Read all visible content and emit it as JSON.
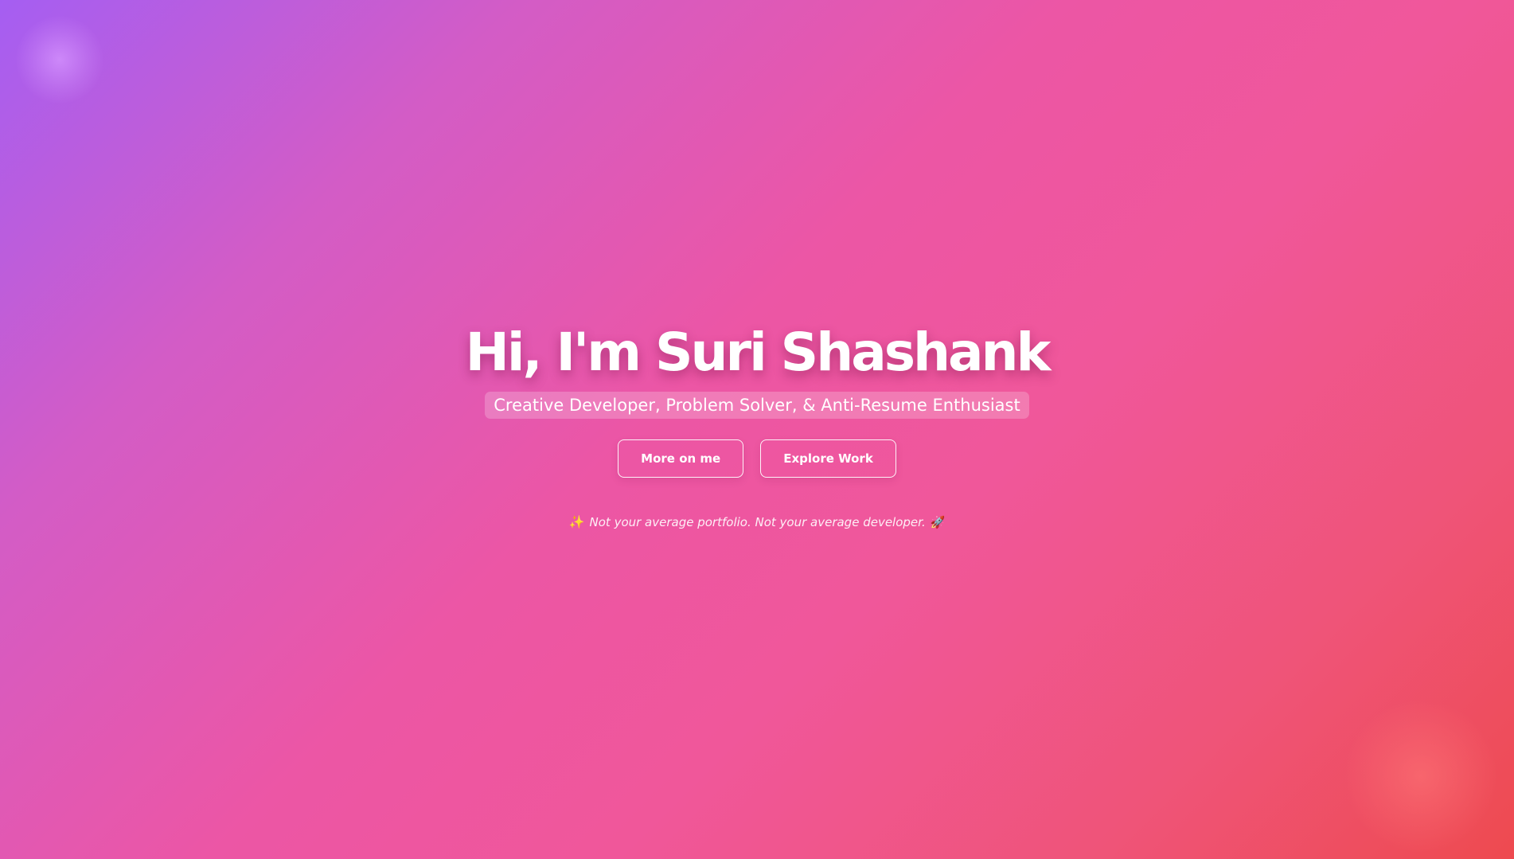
{
  "hero": {
    "title": "Hi, I'm Suri Shashank",
    "subtitle": "Creative Developer, Problem Solver, & Anti-Resume Enthusiast",
    "buttons": [
      {
        "label": "More on me"
      },
      {
        "label": "Explore Work"
      }
    ],
    "tagline": {
      "text": "Not your average portfolio. Not your average developer.",
      "leading_icon": "sparkle-icon",
      "leading_glyph": "✨",
      "trailing_icon": "rocket-icon",
      "trailing_glyph": "🚀"
    }
  },
  "colors": {
    "gradient_start": "#a55ef2",
    "gradient_mid": "#f0579a",
    "gradient_end": "#ee4a4f",
    "text": "#ffffff"
  }
}
